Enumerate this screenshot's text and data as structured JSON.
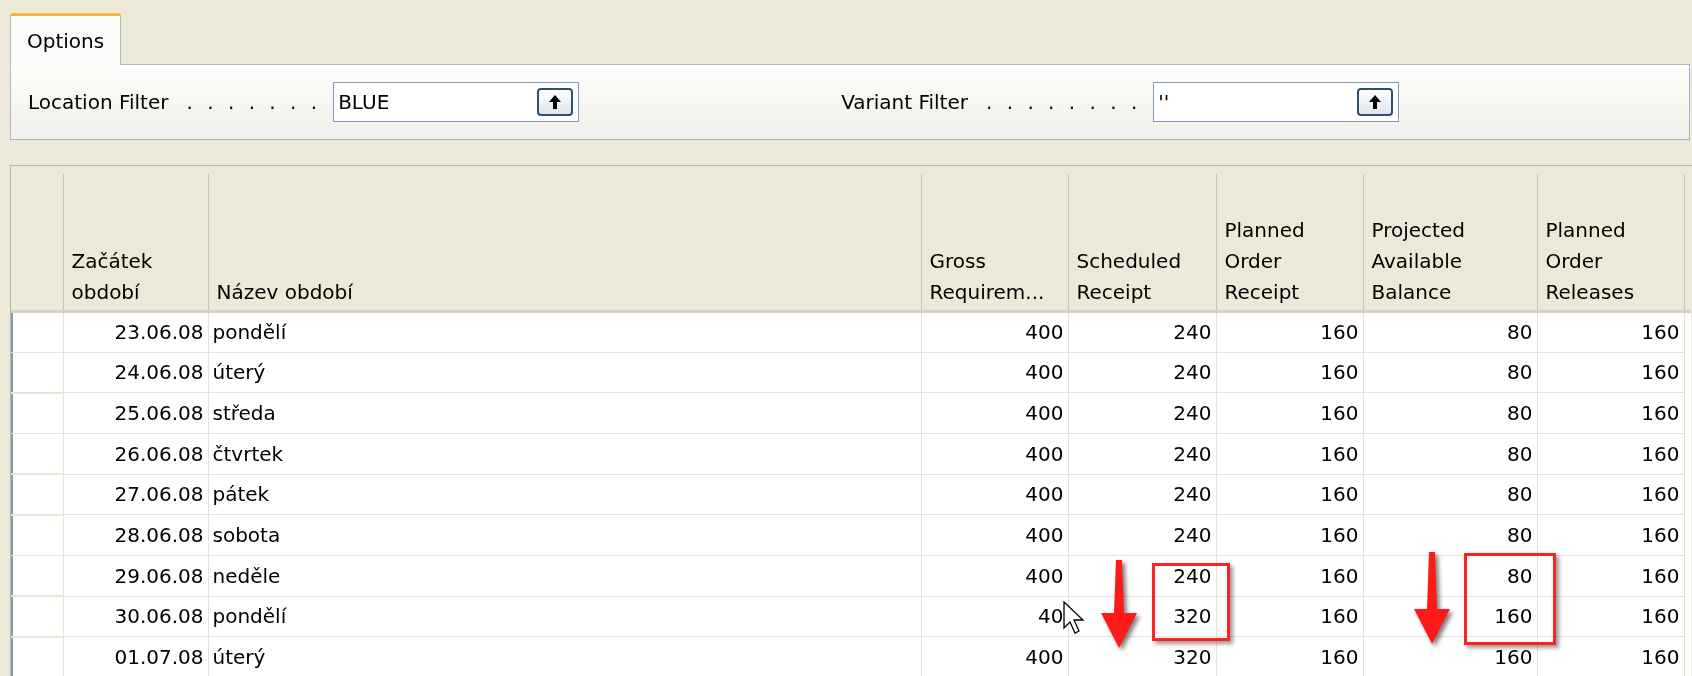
{
  "tabs": [
    {
      "label": "Options",
      "selected": true
    }
  ],
  "filters": [
    {
      "label": "Location Filter",
      "dots": ". . . . . . .",
      "value": "BLUE"
    },
    {
      "label": "Variant Filter",
      "dots": ". . . . . . . .",
      "value": "''"
    }
  ],
  "table": {
    "columns": [
      "Začátek období",
      "Název období",
      "Gross Requirem...",
      "Scheduled Receipt",
      "Planned Order Receipt",
      "Projected Available Balance",
      "Planned Order Releases"
    ],
    "rows": [
      [
        "23.06.08",
        "pondělí",
        "400",
        "240",
        "160",
        "80",
        "160"
      ],
      [
        "24.06.08",
        "úterý",
        "400",
        "240",
        "160",
        "80",
        "160"
      ],
      [
        "25.06.08",
        "středa",
        "400",
        "240",
        "160",
        "80",
        "160"
      ],
      [
        "26.06.08",
        "čtvrtek",
        "400",
        "240",
        "160",
        "80",
        "160"
      ],
      [
        "27.06.08",
        "pátek",
        "400",
        "240",
        "160",
        "80",
        "160"
      ],
      [
        "28.06.08",
        "sobota",
        "400",
        "240",
        "160",
        "80",
        "160"
      ],
      [
        "29.06.08",
        "neděle",
        "400",
        "240",
        "160",
        "80",
        "160"
      ],
      [
        "30.06.08",
        "pondělí",
        "40",
        "320",
        "160",
        "160",
        "160"
      ],
      [
        "01.07.08",
        "úterý",
        "400",
        "320",
        "160",
        "160",
        "160"
      ]
    ]
  }
}
